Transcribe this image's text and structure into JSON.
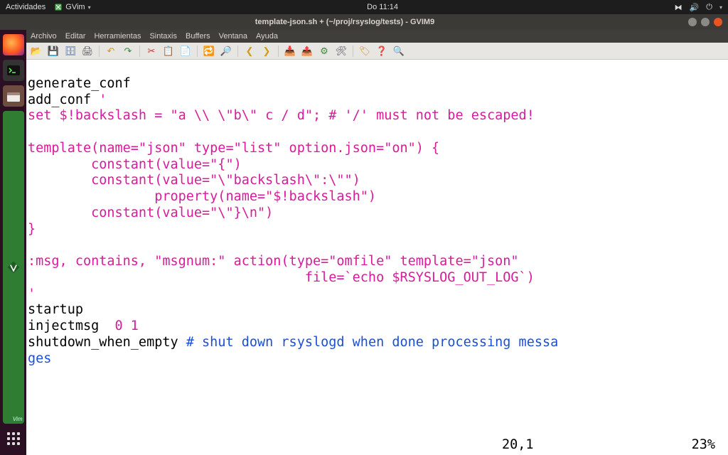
{
  "gnome": {
    "activities": "Actividades",
    "app_name": "GVim",
    "clock": "Do 11:14"
  },
  "window": {
    "title": "template-json.sh + (~/proj/rsyslog/tests) - GVIM9"
  },
  "menubar": {
    "items": [
      "Archivo",
      "Editar",
      "Herramientas",
      "Sintaxis",
      "Buffers",
      "Ventana",
      "Ayuda"
    ]
  },
  "code": {
    "l1": "generate_conf",
    "l2a": "add_conf ",
    "l2b": "'",
    "l3": "set $!backslash = \"a \\\\ \\\"b\\\" c / d\"; # '/' must not be escaped!",
    "l4": "",
    "l5": "template(name=\"json\" type=\"list\" option.json=\"on\") {",
    "l6": "        constant(value=\"{\")",
    "l7": "        constant(value=\"\\\"backslash\\\":\\\"\")",
    "l8": "                property(name=\"$!backslash\")",
    "l9": "        constant(value=\"\\\"}\\n\")",
    "l10": "}",
    "l11": "",
    "l12": ":msg, contains, \"msgnum:\" action(type=\"omfile\" template=\"json\"",
    "l13": "                                   file=`echo $RSYSLOG_OUT_LOG`)",
    "l14": "'",
    "l15": "startup",
    "l16a": "injectmsg  ",
    "l16b": "0 1",
    "l17a": "shutdown_when_empty ",
    "l17b": "# shut down rsyslogd when done processing messa",
    "l18": "ges"
  },
  "status": {
    "pos": "20,1",
    "pct": "23%"
  }
}
